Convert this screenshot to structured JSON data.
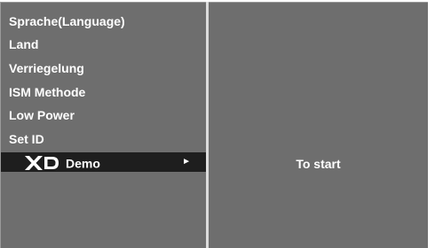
{
  "menu": {
    "items": [
      {
        "label": "Sprache(Language)"
      },
      {
        "label": "Land"
      },
      {
        "label": "Verriegelung"
      },
      {
        "label": "ISM Methode"
      },
      {
        "label": "Low Power"
      },
      {
        "label": "Set ID"
      }
    ],
    "selected": {
      "logo": "XD",
      "label": "Demo",
      "arrow_icon": "right-triangle-icon"
    }
  },
  "submenu": {
    "action_label": "To start"
  },
  "colors": {
    "panel": "#6e6e6e",
    "selected_row": "#1e1e1e",
    "text": "#ffffff"
  }
}
